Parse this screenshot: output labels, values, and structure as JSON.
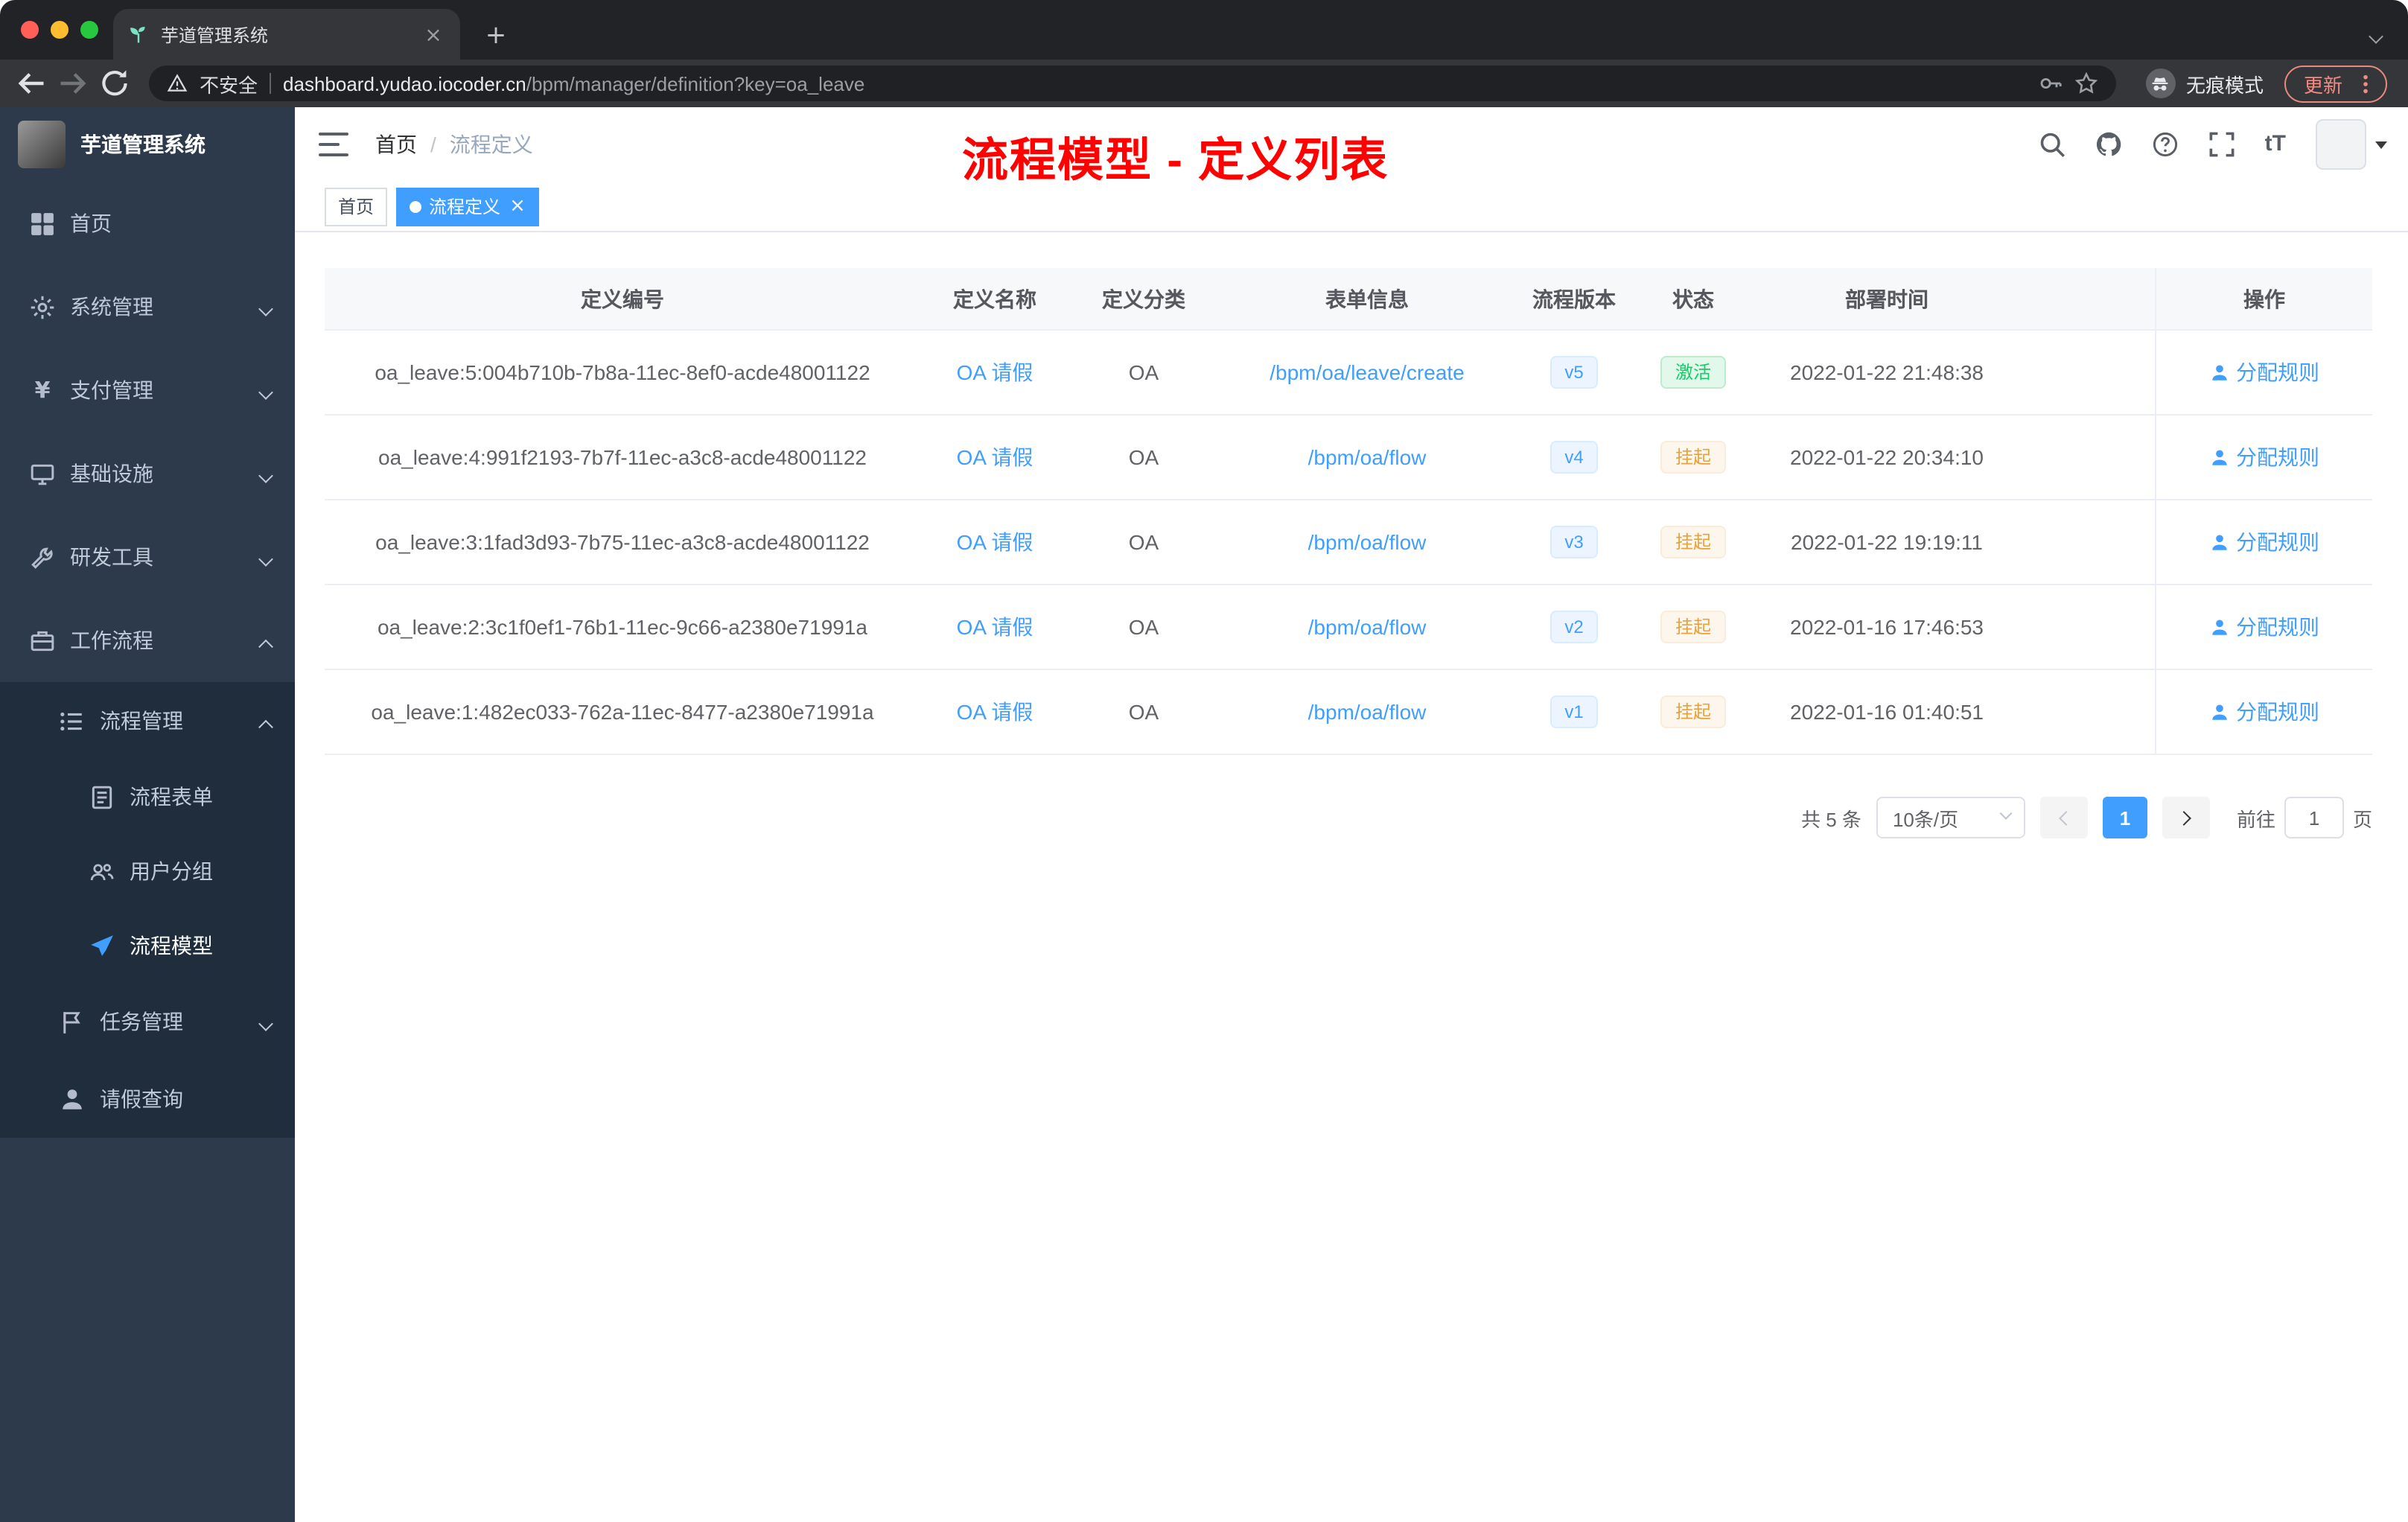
{
  "browser": {
    "tab_title": "芋道管理系统",
    "security_label": "不安全",
    "url_domain": "dashboard.yudao.iocoder.cn",
    "url_path": "/bpm/manager/definition?key=oa_leave",
    "profile_label": "无痕模式",
    "update_label": "更新"
  },
  "sidebar": {
    "app_title": "芋道管理系统",
    "items": [
      {
        "key": "home",
        "label": "首页",
        "icon": "dashboard-icon",
        "level": 1,
        "arrow": null,
        "active": false
      },
      {
        "key": "system",
        "label": "系统管理",
        "icon": "gear-icon",
        "level": 1,
        "arrow": "down",
        "active": false
      },
      {
        "key": "payment",
        "label": "支付管理",
        "icon": "yen-icon",
        "level": 1,
        "arrow": "down",
        "active": false
      },
      {
        "key": "infrastructure",
        "label": "基础设施",
        "icon": "infra-icon",
        "level": 1,
        "arrow": "down",
        "active": false
      },
      {
        "key": "dev-tools",
        "label": "研发工具",
        "icon": "tools-icon",
        "level": 1,
        "arrow": "down",
        "active": false
      },
      {
        "key": "workflow",
        "label": "工作流程",
        "icon": "workflow-icon",
        "level": 1,
        "arrow": "up",
        "active": false
      },
      {
        "key": "process-mgmt",
        "label": "流程管理",
        "icon": "process-icon",
        "level": 2,
        "arrow": "up",
        "active": false
      },
      {
        "key": "process-form",
        "label": "流程表单",
        "icon": "form-icon",
        "level": 3,
        "arrow": null,
        "active": false
      },
      {
        "key": "user-group",
        "label": "用户分组",
        "icon": "group-icon",
        "level": 3,
        "arrow": null,
        "active": false
      },
      {
        "key": "process-model",
        "label": "流程模型",
        "icon": "model-icon",
        "level": 3,
        "arrow": null,
        "active": true
      },
      {
        "key": "task-mgmt",
        "label": "任务管理",
        "icon": "task-icon",
        "level": 2,
        "arrow": "down",
        "active": false
      },
      {
        "key": "leave-query",
        "label": "请假查询",
        "icon": "user-icon",
        "level": 2,
        "arrow": null,
        "active": false
      }
    ]
  },
  "header": {
    "breadcrumb": [
      "首页",
      "流程定义"
    ],
    "breadcrumb_separator": "/",
    "annotation": "流程模型 - 定义列表"
  },
  "tags": [
    {
      "label": "首页",
      "active": false
    },
    {
      "label": "流程定义",
      "active": true
    }
  ],
  "table": {
    "columns": [
      "定义编号",
      "定义名称",
      "定义分类",
      "表单信息",
      "流程版本",
      "状态",
      "部署时间",
      "操作"
    ],
    "rows": [
      {
        "id": "oa_leave:5:004b710b-7b8a-11ec-8ef0-acde48001122",
        "name": "OA 请假",
        "category": "OA",
        "form": "/bpm/oa/leave/create",
        "version": "v5",
        "status": "激活",
        "status_type": "active",
        "time": "2022-01-22 21:48:38",
        "action": "分配规则"
      },
      {
        "id": "oa_leave:4:991f2193-7b7f-11ec-a3c8-acde48001122",
        "name": "OA 请假",
        "category": "OA",
        "form": "/bpm/oa/flow",
        "version": "v4",
        "status": "挂起",
        "status_type": "suspended",
        "time": "2022-01-22 20:34:10",
        "action": "分配规则"
      },
      {
        "id": "oa_leave:3:1fad3d93-7b75-11ec-a3c8-acde48001122",
        "name": "OA 请假",
        "category": "OA",
        "form": "/bpm/oa/flow",
        "version": "v3",
        "status": "挂起",
        "status_type": "suspended",
        "time": "2022-01-22 19:19:11",
        "action": "分配规则"
      },
      {
        "id": "oa_leave:2:3c1f0ef1-76b1-11ec-9c66-a2380e71991a",
        "name": "OA 请假",
        "category": "OA",
        "form": "/bpm/oa/flow",
        "version": "v2",
        "status": "挂起",
        "status_type": "suspended",
        "time": "2022-01-16 17:46:53",
        "action": "分配规则"
      },
      {
        "id": "oa_leave:1:482ec033-762a-11ec-8477-a2380e71991a",
        "name": "OA 请假",
        "category": "OA",
        "form": "/bpm/oa/flow",
        "version": "v1",
        "status": "挂起",
        "status_type": "suspended",
        "time": "2022-01-16 01:40:51",
        "action": "分配规则"
      }
    ]
  },
  "pagination": {
    "total_label": "共 5 条",
    "page_size": "10条/页",
    "current_page": "1",
    "goto_label": "前往",
    "goto_value": "1",
    "page_suffix": "页"
  },
  "colors": {
    "accent": "#409eff",
    "annotation_red": "#fe0100",
    "status_active": "#13ce66",
    "status_suspended": "#e6a23c",
    "sidebar_bg": "#2d3a4b",
    "submenu_bg": "#1f2d3d"
  }
}
